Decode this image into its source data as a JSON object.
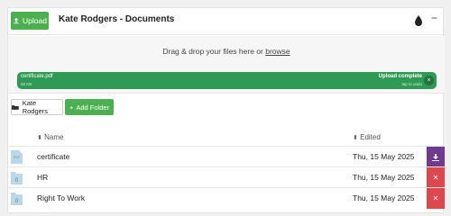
{
  "header": {
    "upload_label": "Upload",
    "title": "Kate Rodgers - Documents",
    "minimize_glyph": "−"
  },
  "dropzone": {
    "text_prefix": "Drag & drop your files here or ",
    "browse_label": "browse"
  },
  "uploaded_file": {
    "name": "certificate.pdf",
    "size": "50 KB",
    "status": "Upload complete",
    "hint": "tap to undo",
    "close_glyph": "×"
  },
  "folder_nav": {
    "current_folder": "Kate Rodgers",
    "add_folder_label": "Add Folder"
  },
  "table": {
    "col_name": "Name",
    "col_edited": "Edited",
    "rows": [
      {
        "name": "certificate",
        "date": "Thu, 15 May 2025",
        "badge": "PDF",
        "type": "file",
        "action": "download"
      },
      {
        "name": "HR",
        "date": "Thu, 15 May 2025",
        "badge": "0",
        "type": "folder",
        "action": "delete"
      },
      {
        "name": "Right To Work",
        "date": "Thu, 15 May 2025",
        "badge": "0",
        "type": "folder",
        "action": "delete"
      }
    ]
  },
  "colors": {
    "primary_green": "#4caf50",
    "upload_complete_green": "#2e9a55",
    "download_purple": "#6f3a8f",
    "delete_red": "#e0474c",
    "file_icon_blue": "#bcd8e8"
  }
}
